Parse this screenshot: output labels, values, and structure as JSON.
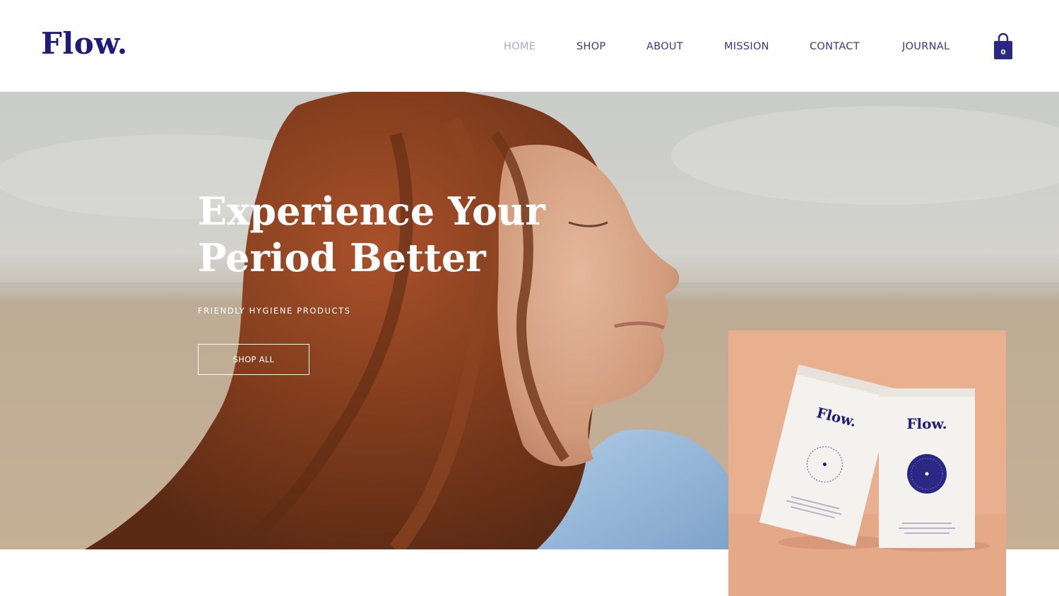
{
  "brand": {
    "logo": "Flow.",
    "color": "#1f1b78"
  },
  "nav": {
    "items": [
      {
        "label": "HOME",
        "active": true
      },
      {
        "label": "SHOP",
        "active": false
      },
      {
        "label": "ABOUT",
        "active": false
      },
      {
        "label": "MISSION",
        "active": false
      },
      {
        "label": "CONTACT",
        "active": false
      },
      {
        "label": "JOURNAL",
        "active": false
      }
    ],
    "color": "#3b3689",
    "active_color": "#a9a7cf"
  },
  "cart": {
    "icon": "shopping-bag-icon",
    "count": "0"
  },
  "hero": {
    "headline_line1": "Experience Your",
    "headline_line2": "Period Better",
    "tagline": "FRIENDLY HYGIENE PRODUCTS",
    "cta_label": "SHOP ALL"
  },
  "product": {
    "background": "#e9b08f",
    "box_brand": "Flow.",
    "box_color": "#f4f2ee"
  }
}
